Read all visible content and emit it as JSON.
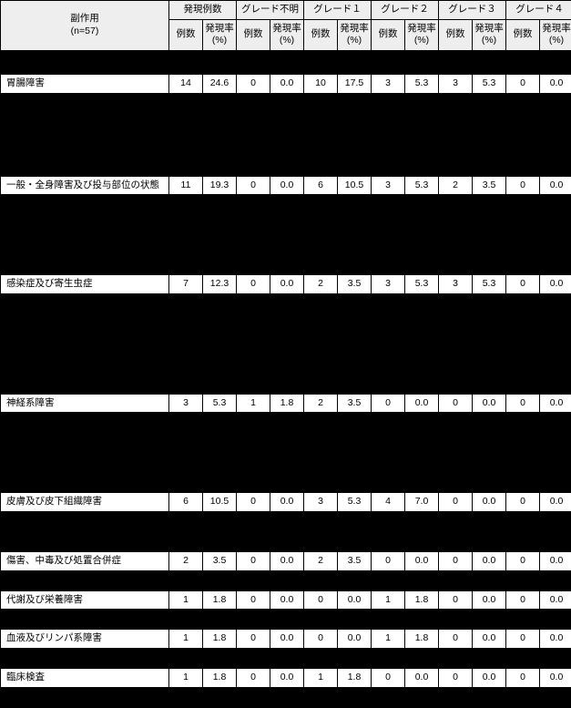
{
  "header": {
    "col1_line1": "副作用",
    "col1_line2": "(n=57)",
    "groups": [
      "発現例数",
      "グレード不明",
      "グレード１",
      "グレード２",
      "グレード３",
      "グレード４"
    ],
    "sub_count": "例数",
    "sub_rate": "発現率\n(%)"
  },
  "rows": [
    {
      "t": "sep"
    },
    {
      "t": "black",
      "span": [
        0,
        1,
        2,
        3,
        4,
        5,
        6,
        7,
        8,
        9,
        10,
        11,
        12
      ]
    },
    {
      "t": "data",
      "label": "胃腸障害",
      "v": [
        "14",
        "24.6",
        "0",
        "0.0",
        "10",
        "17.5",
        "3",
        "5.3",
        "3",
        "5.3",
        "0",
        "0.0"
      ]
    },
    {
      "t": "black"
    },
    {
      "t": "black"
    },
    {
      "t": "black"
    },
    {
      "t": "sep2"
    },
    {
      "t": "black"
    },
    {
      "t": "data",
      "label": "一般・全身障害及び投与部位の状態",
      "v": [
        "11",
        "19.3",
        "0",
        "0.0",
        "6",
        "10.5",
        "3",
        "5.3",
        "2",
        "3.5",
        "0",
        "0.0"
      ]
    },
    {
      "t": "black"
    },
    {
      "t": "black"
    },
    {
      "t": "black"
    },
    {
      "t": "black"
    },
    {
      "t": "data",
      "label": "感染症及び寄生虫症",
      "v": [
        "7",
        "12.3",
        "0",
        "0.0",
        "2",
        "3.5",
        "3",
        "5.3",
        "3",
        "5.3",
        "0",
        "0.0"
      ]
    },
    {
      "t": "black"
    },
    {
      "t": "black"
    },
    {
      "t": "black"
    },
    {
      "t": "black"
    },
    {
      "t": "black"
    },
    {
      "t": "data",
      "label": "神経系障害",
      "v": [
        "3",
        "5.3",
        "1",
        "1.8",
        "2",
        "3.5",
        "0",
        "0.0",
        "0",
        "0.0",
        "0",
        "0.0"
      ]
    },
    {
      "t": "black"
    },
    {
      "t": "black"
    },
    {
      "t": "black"
    },
    {
      "t": "black"
    },
    {
      "t": "data",
      "label": "皮膚及び皮下組織障害",
      "v": [
        "6",
        "10.5",
        "0",
        "0.0",
        "3",
        "5.3",
        "4",
        "7.0",
        "0",
        "0.0",
        "0",
        "0.0"
      ]
    },
    {
      "t": "black"
    },
    {
      "t": "black"
    },
    {
      "t": "data",
      "label": "傷害、中毒及び処置合併症",
      "v": [
        "2",
        "3.5",
        "0",
        "0.0",
        "2",
        "3.5",
        "0",
        "0.0",
        "0",
        "0.0",
        "0",
        "0.0"
      ]
    },
    {
      "t": "black"
    },
    {
      "t": "data",
      "label": "代謝及び栄養障害",
      "v": [
        "1",
        "1.8",
        "0",
        "0.0",
        "0",
        "0.0",
        "1",
        "1.8",
        "0",
        "0.0",
        "0",
        "0.0"
      ]
    },
    {
      "t": "black"
    },
    {
      "t": "data",
      "label": "血液及びリンパ系障害",
      "v": [
        "1",
        "1.8",
        "0",
        "0.0",
        "0",
        "0.0",
        "1",
        "1.8",
        "0",
        "0.0",
        "0",
        "0.0"
      ]
    },
    {
      "t": "black"
    },
    {
      "t": "data",
      "label": "臨床検査",
      "v": [
        "1",
        "1.8",
        "0",
        "0.0",
        "1",
        "1.8",
        "0",
        "0.0",
        "0",
        "0.0",
        "0",
        "0.0"
      ]
    },
    {
      "t": "black"
    }
  ]
}
